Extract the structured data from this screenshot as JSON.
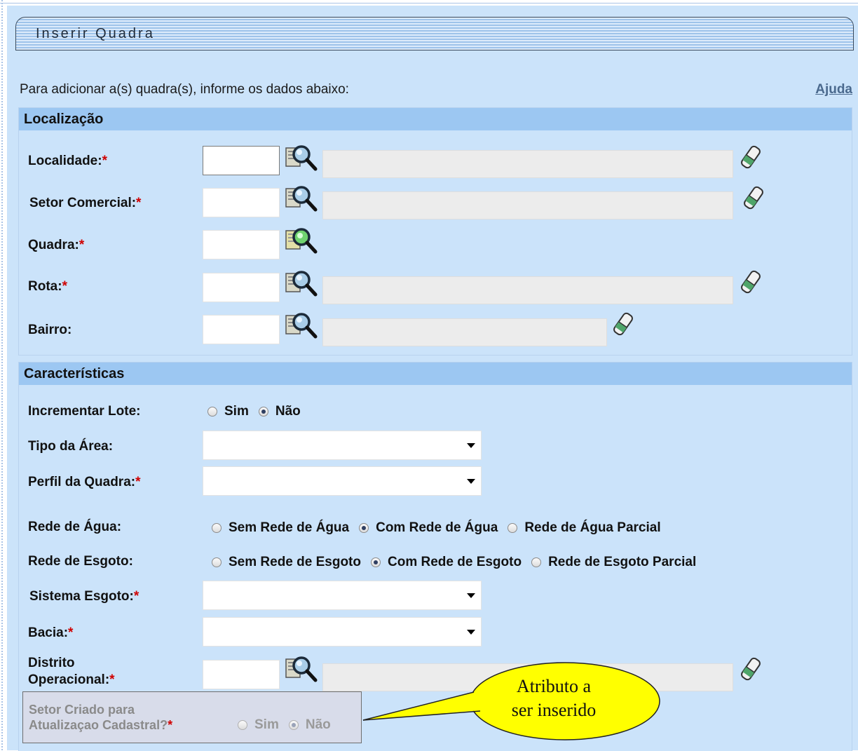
{
  "window": {
    "title": "Inserir Quadra"
  },
  "intro": {
    "text": "Para adicionar a(s) quadra(s), informe os dados abaixo:",
    "help_label": "Ajuda"
  },
  "localizacao": {
    "header": "Localização",
    "fields": {
      "localidade": {
        "label": "Localidade:",
        "required_mark": "*",
        "value": ""
      },
      "setor": {
        "label": "Setor Comercial:",
        "required_mark": "*",
        "value": ""
      },
      "quadra": {
        "label": "Quadra:",
        "required_mark": "*",
        "value": ""
      },
      "rota": {
        "label": "Rota:",
        "required_mark": "*",
        "value": ""
      },
      "bairro": {
        "label": "Bairro:",
        "value": ""
      }
    }
  },
  "caracteristicas": {
    "header": "Características",
    "incrementar_lote": {
      "label": "Incrementar Lote:",
      "options": [
        "Sim",
        "Não"
      ],
      "selected": "Não"
    },
    "tipo_area": {
      "label": "Tipo da Área:",
      "value": ""
    },
    "perfil_quadra": {
      "label": "Perfil da Quadra:",
      "required_mark": "*",
      "value": ""
    },
    "rede_agua": {
      "label": "Rede de Água:",
      "options": [
        "Sem Rede de Água",
        "Com Rede de Água",
        "Rede de Água Parcial"
      ],
      "selected": "Com Rede de Água"
    },
    "rede_esgoto": {
      "label": "Rede de Esgoto:",
      "options": [
        "Sem Rede de Esgoto",
        "Com Rede de Esgoto",
        "Rede de Esgoto Parcial"
      ],
      "selected": "Com Rede de Esgoto"
    },
    "sistema_esgoto": {
      "label": "Sistema Esgoto:",
      "required_mark": "*",
      "value": ""
    },
    "bacia": {
      "label": "Bacia:",
      "required_mark": "*",
      "value": ""
    },
    "distrito": {
      "label_line1": "Distrito",
      "label_line2": "Operacional:",
      "required_mark": "*",
      "value": ""
    },
    "setor_criado": {
      "label_line1": "Setor Criado para",
      "label_line2": "Atualizaçao Cadastral?",
      "required_mark": "*",
      "options": [
        "Sim",
        "Não"
      ],
      "selected": "Não"
    }
  },
  "callout": {
    "line1": "Atributo a",
    "line2": "ser inserido",
    "fill": "#ffff00"
  },
  "colors": {
    "panel_bg": "#cbe3fa",
    "section_header_bg": "#9cc7f2",
    "required": "#d00000",
    "link": "#4b6a8e"
  },
  "icons": {
    "search": "magnifier-icon",
    "search_new": "magnifier-green-icon",
    "clear": "eraser-icon"
  }
}
